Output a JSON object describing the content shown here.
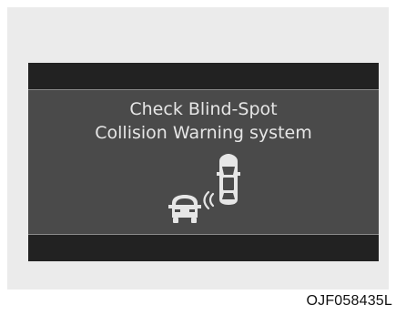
{
  "display": {
    "line1": "Check Blind-Spot",
    "line2": "Collision Warning system"
  },
  "icons": {
    "main": "blind-spot-collision-warning-icon"
  },
  "colors": {
    "display_bar": "#222222",
    "display_panel": "#4a4a4a",
    "text": "#e6e6e6"
  },
  "caption": "OJF058435L"
}
